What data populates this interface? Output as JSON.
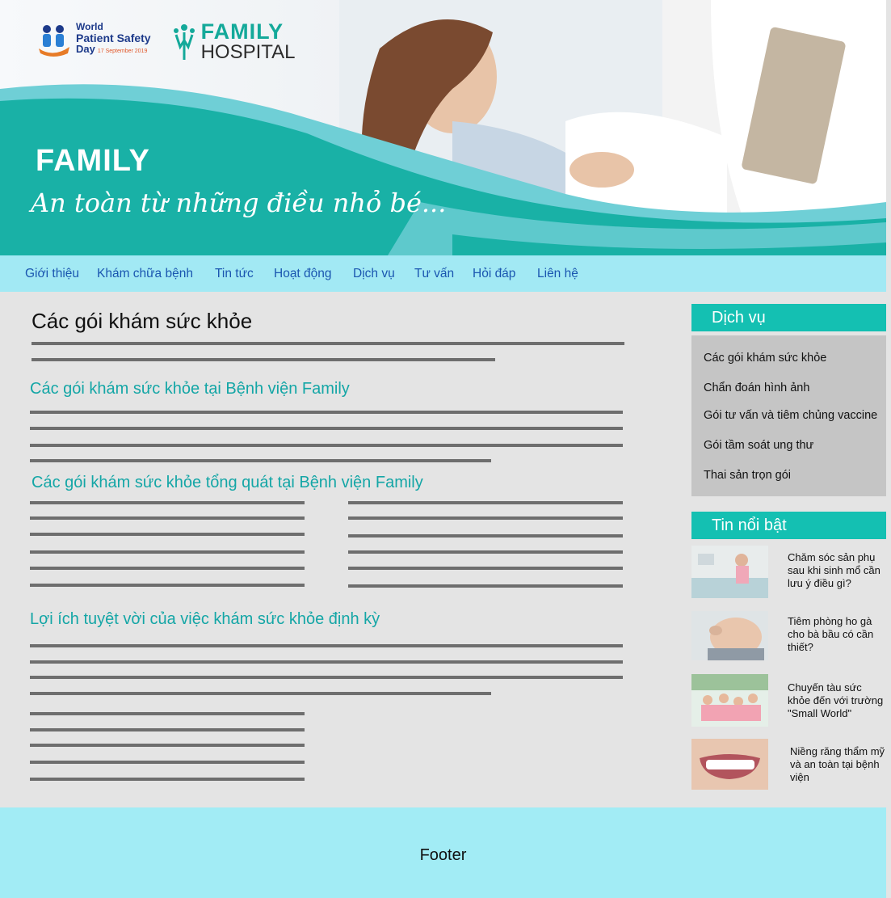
{
  "header": {
    "event_logo": {
      "line1": "World",
      "line2": "Patient Safety",
      "line3": "Day",
      "date": "17 September 2019"
    },
    "hospital_logo": {
      "line1": "FAMILY",
      "line2": "HOSPITAL"
    },
    "title": "FAMILY",
    "slogan": "An toàn từ những điều nhỏ bé..."
  },
  "nav": {
    "items": [
      "Giới thiệu",
      "Khám chữa bệnh",
      "Tin tức",
      "Hoạt động",
      "Dịch vụ",
      "Tư vấn",
      "Hỏi đáp",
      "Liên hệ"
    ]
  },
  "main": {
    "page_title": "Các gói khám sức khỏe",
    "sections": [
      {
        "title": "Các gói khám sức khỏe tại Bệnh viện Family"
      },
      {
        "title": "Các gói khám sức khỏe tổng quát tại Bệnh viện Family"
      },
      {
        "title": "Lợi ích tuyệt vời của việc khám sức khỏe định kỳ"
      }
    ]
  },
  "sidebar": {
    "services": {
      "title": "Dịch vụ",
      "items": [
        "Các gói khám sức khỏe",
        "Chẩn đoán hình ảnh",
        "Gói tư vấn và tiêm chủng vaccine",
        "Gói tầm soát ung thư",
        "Thai sản trọn gói"
      ]
    },
    "news": {
      "title": "Tin nổi bật",
      "items": [
        {
          "text": "Chăm sóc sản phụ sau khi sinh mổ cần lưu ý điều gì?"
        },
        {
          "text": "Tiêm phòng ho gà cho bà bầu có cần thiết?"
        },
        {
          "text": "Chuyến tàu sức khỏe đến với trường \"Small World\""
        },
        {
          "text": "Niềng răng thẩm mỹ và an toàn tại bệnh viện"
        }
      ]
    }
  },
  "footer": {
    "label": "Footer"
  },
  "colors": {
    "teal": "#14c0b2",
    "nav_bg": "#a2e9f4",
    "link": "#1a56b0",
    "section_title": "#14a6a6"
  }
}
